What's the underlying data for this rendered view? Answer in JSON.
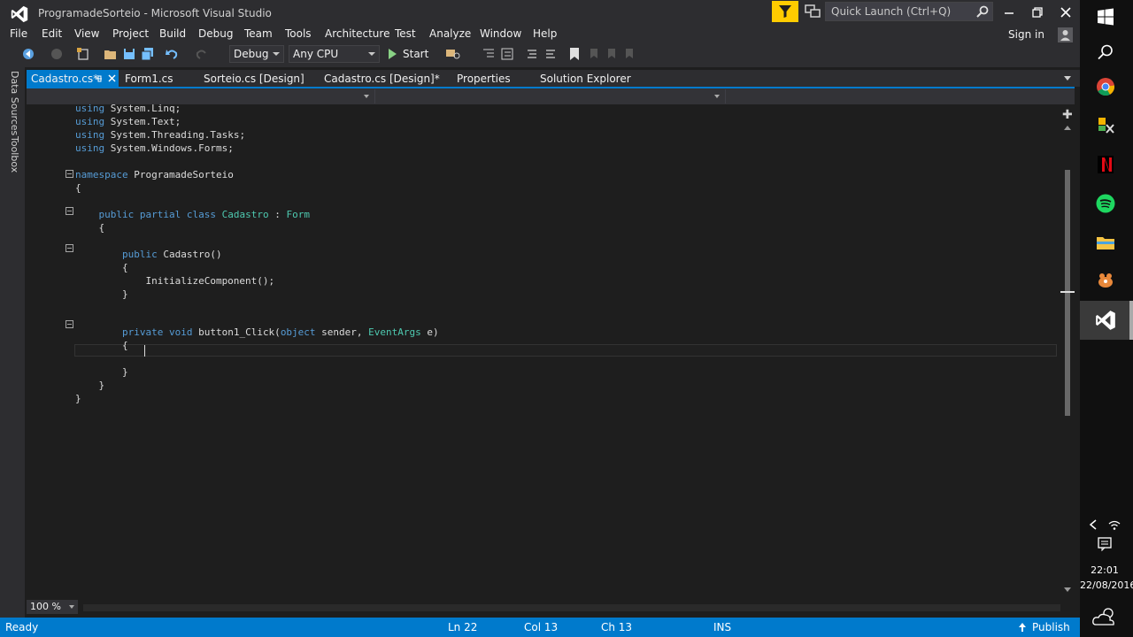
{
  "window": {
    "title": "ProgramadeSorteio - Microsoft Visual Studio",
    "quick_launch_placeholder": "Quick Launch (Ctrl+Q)",
    "sign_in": "Sign in"
  },
  "menu": [
    "File",
    "Edit",
    "View",
    "Project",
    "Build",
    "Debug",
    "Team",
    "Tools",
    "Architecture",
    "Test",
    "Analyze",
    "Window",
    "Help"
  ],
  "toolbar": {
    "configuration": "Debug",
    "platform": "Any CPU",
    "start_label": "Start"
  },
  "side_tabs": [
    "Data Sources",
    "Toolbox"
  ],
  "tabs": [
    {
      "label": "Cadastro.cs*",
      "active": true
    },
    {
      "label": "Form1.cs"
    },
    {
      "label": "Sorteio.cs [Design]"
    },
    {
      "label": "Cadastro.cs [Design]*"
    },
    {
      "label": "Properties"
    },
    {
      "label": "Solution Explorer"
    }
  ],
  "code_lines": [
    [
      {
        "t": "using",
        "k": "kw"
      },
      {
        "t": " System.Linq;"
      }
    ],
    [
      {
        "t": "using",
        "k": "kw"
      },
      {
        "t": " System.Text;"
      }
    ],
    [
      {
        "t": "using",
        "k": "kw"
      },
      {
        "t": " System.Threading.Tasks;"
      }
    ],
    [
      {
        "t": "using",
        "k": "kw"
      },
      {
        "t": " System.Windows.Forms;"
      }
    ],
    [],
    [
      {
        "t": "namespace",
        "k": "kw"
      },
      {
        "t": " ProgramadeSorteio"
      }
    ],
    [
      {
        "t": "{"
      }
    ],
    [],
    [
      {
        "t": "    "
      },
      {
        "t": "public",
        "k": "kw"
      },
      {
        "t": " "
      },
      {
        "t": "partial",
        "k": "kw"
      },
      {
        "t": " "
      },
      {
        "t": "class",
        "k": "kw"
      },
      {
        "t": " "
      },
      {
        "t": "Cadastro",
        "k": "ty"
      },
      {
        "t": " : "
      },
      {
        "t": "Form",
        "k": "ty"
      }
    ],
    [
      {
        "t": "    {"
      }
    ],
    [],
    [
      {
        "t": "        "
      },
      {
        "t": "public",
        "k": "kw"
      },
      {
        "t": " Cadastro()"
      }
    ],
    [
      {
        "t": "        {"
      }
    ],
    [
      {
        "t": "            InitializeComponent();"
      }
    ],
    [
      {
        "t": "        }"
      }
    ],
    [],
    [],
    [
      {
        "t": "        "
      },
      {
        "t": "private",
        "k": "kw"
      },
      {
        "t": " "
      },
      {
        "t": "void",
        "k": "kw"
      },
      {
        "t": " button1_Click("
      },
      {
        "t": "object",
        "k": "kw"
      },
      {
        "t": " sender, "
      },
      {
        "t": "EventArgs",
        "k": "ty"
      },
      {
        "t": " e)"
      }
    ],
    [
      {
        "t": "        {"
      }
    ],
    [],
    [
      {
        "t": "        }"
      }
    ],
    [
      {
        "t": "    }"
      }
    ],
    [
      {
        "t": "}"
      }
    ]
  ],
  "zoom": "100 %",
  "status": {
    "ready": "Ready",
    "ln": "Ln 22",
    "col": "Col 13",
    "ch": "Ch 13",
    "ins": "INS",
    "publish": "Publish"
  },
  "clock": {
    "time": "22:01",
    "date": "22/08/2016"
  },
  "colors": {
    "accent": "#007acc",
    "keyword": "#569cd6",
    "type": "#4ec9b0",
    "filter_bg": "#ffcc00"
  }
}
